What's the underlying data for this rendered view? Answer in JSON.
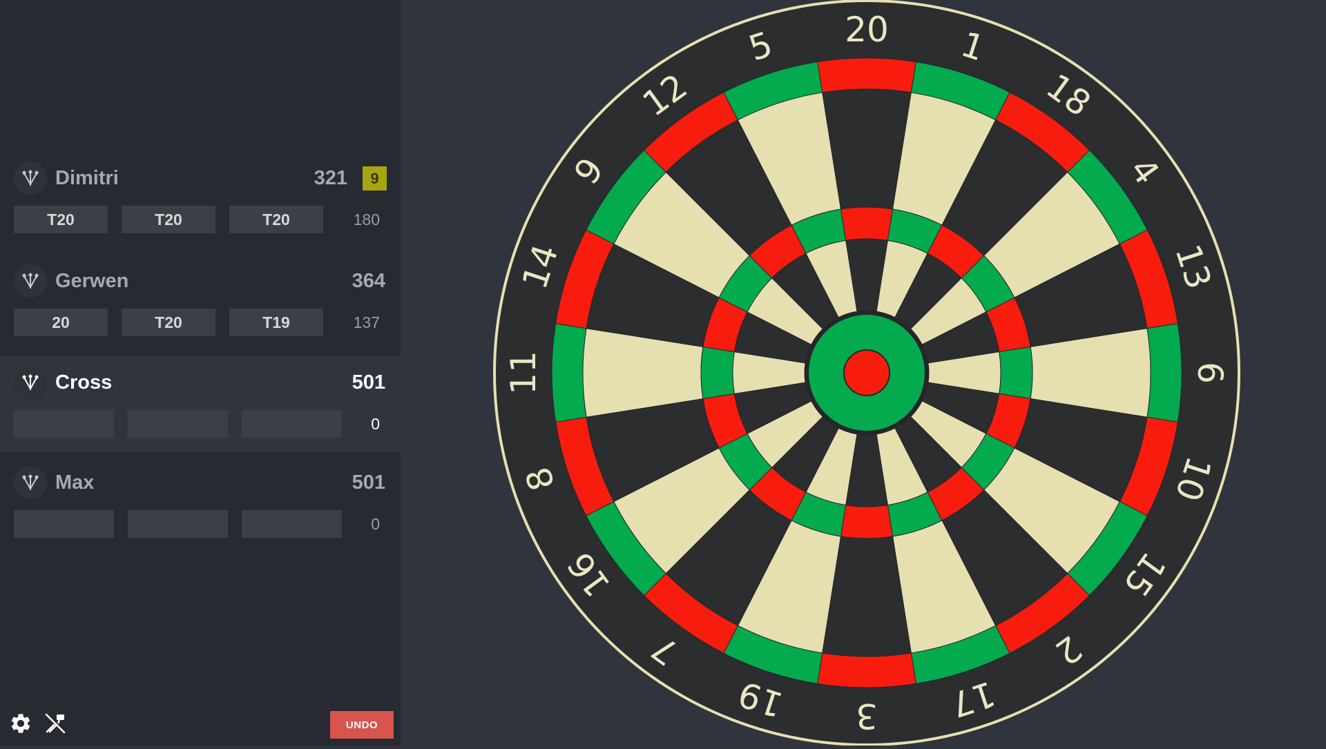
{
  "players": [
    {
      "name": "Dimitri",
      "score": "321",
      "badge": "9",
      "throws": [
        "T20",
        "T20",
        "T20"
      ],
      "total": "180",
      "active": false
    },
    {
      "name": "Gerwen",
      "score": "364",
      "badge": "",
      "throws": [
        "20",
        "T20",
        "T19"
      ],
      "total": "137",
      "active": false
    },
    {
      "name": "Cross",
      "score": "501",
      "badge": "",
      "throws": [
        "",
        "",
        ""
      ],
      "total": "0",
      "active": true
    },
    {
      "name": "Max",
      "score": "501",
      "badge": "",
      "throws": [
        "",
        "",
        ""
      ],
      "total": "0",
      "active": false
    }
  ],
  "controls": {
    "undo_label": "UNDO",
    "settings_icon": "gear-icon",
    "mute_icon": "darts-off-icon"
  },
  "dartboard": {
    "numbers": [
      "20",
      "1",
      "18",
      "4",
      "13",
      "6",
      "10",
      "15",
      "2",
      "17",
      "3",
      "19",
      "7",
      "16",
      "8",
      "11",
      "14",
      "9",
      "12",
      "5"
    ],
    "colors": {
      "black": "#2b2d2f",
      "cream": "#e6e0b0",
      "red": "#f81c0e",
      "green": "#03aa4e",
      "rim": "#e6e0b0",
      "number": "#eae6c4"
    }
  },
  "icons": {
    "avatar": "darts-icon"
  }
}
